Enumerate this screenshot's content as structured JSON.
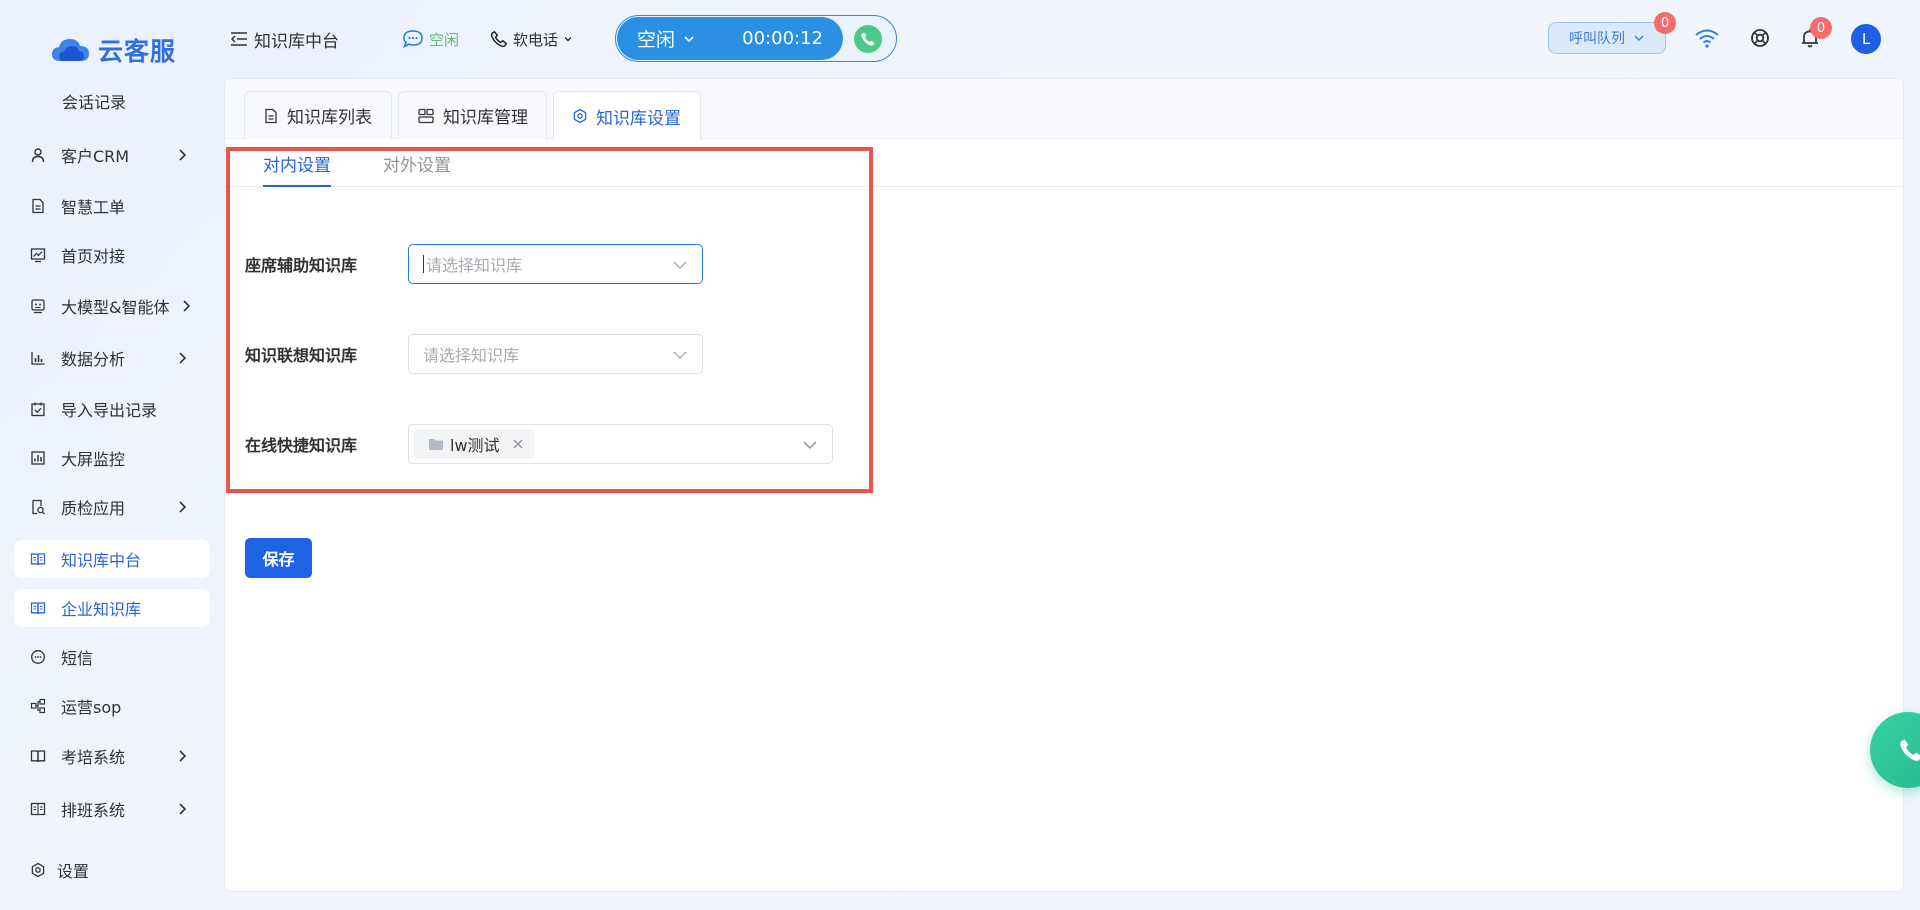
{
  "brand": {
    "name": "云客服"
  },
  "sidebar": {
    "items": [
      {
        "label": "会话记录",
        "icon": "none",
        "arrow": false,
        "active": false
      },
      {
        "label": "客户CRM",
        "icon": "user-icon",
        "arrow": true,
        "active": false
      },
      {
        "label": "智慧工单",
        "icon": "document-icon",
        "arrow": false,
        "active": false
      },
      {
        "label": "首页对接",
        "icon": "chart-line-icon",
        "arrow": false,
        "active": false
      },
      {
        "label": "大模型&智能体",
        "icon": "robot-icon",
        "arrow": true,
        "active": false
      },
      {
        "label": "数据分析",
        "icon": "bar-chart-icon",
        "arrow": true,
        "active": false
      },
      {
        "label": "导入导出记录",
        "icon": "calendar-check-icon",
        "arrow": false,
        "active": false
      },
      {
        "label": "大屏监控",
        "icon": "monitor-chart-icon",
        "arrow": false,
        "active": false
      },
      {
        "label": "质检应用",
        "icon": "inspect-icon",
        "arrow": true,
        "active": false
      },
      {
        "label": "知识库中台",
        "icon": "book-icon",
        "arrow": false,
        "active": true
      },
      {
        "label": "企业知识库",
        "icon": "book-icon",
        "arrow": false,
        "active": true
      },
      {
        "label": "短信",
        "icon": "sms-icon",
        "arrow": false,
        "active": false
      },
      {
        "label": "运营sop",
        "icon": "flow-icon",
        "arrow": false,
        "active": false
      },
      {
        "label": "考培系统",
        "icon": "book-open-icon",
        "arrow": true,
        "active": false
      },
      {
        "label": "排班系统",
        "icon": "schedule-icon",
        "arrow": true,
        "active": false
      },
      {
        "label": "设置",
        "icon": "gear-icon",
        "arrow": false,
        "active": false
      }
    ]
  },
  "header": {
    "title": "知识库中台",
    "agent_status": "空闲",
    "phone_mode": "软电话",
    "call_status": "空闲",
    "call_timer": "00:00:12",
    "queue_label": "呼叫队列",
    "queue_badge": "0",
    "notify_badge": "0",
    "avatar_letter": "L"
  },
  "tabs": [
    {
      "label": "知识库列表",
      "icon": "document-icon",
      "active": false
    },
    {
      "label": "知识库管理",
      "icon": "people-icon",
      "active": false
    },
    {
      "label": "知识库设置",
      "icon": "gear-icon",
      "active": true
    }
  ],
  "subtabs": [
    {
      "label": "对内设置",
      "active": true
    },
    {
      "label": "对外设置",
      "active": false
    }
  ],
  "form": {
    "fields": [
      {
        "label": "座席辅助知识库",
        "placeholder": "请选择知识库",
        "value": null
      },
      {
        "label": "知识联想知识库",
        "placeholder": "请选择知识库",
        "value": null
      },
      {
        "label": "在线快捷知识库",
        "placeholder": "",
        "value": "lw测试"
      }
    ],
    "save_label": "保存"
  },
  "colors": {
    "primary": "#1f63e5",
    "highlight_box": "#e8544f",
    "status_idle": "#5fb878"
  }
}
